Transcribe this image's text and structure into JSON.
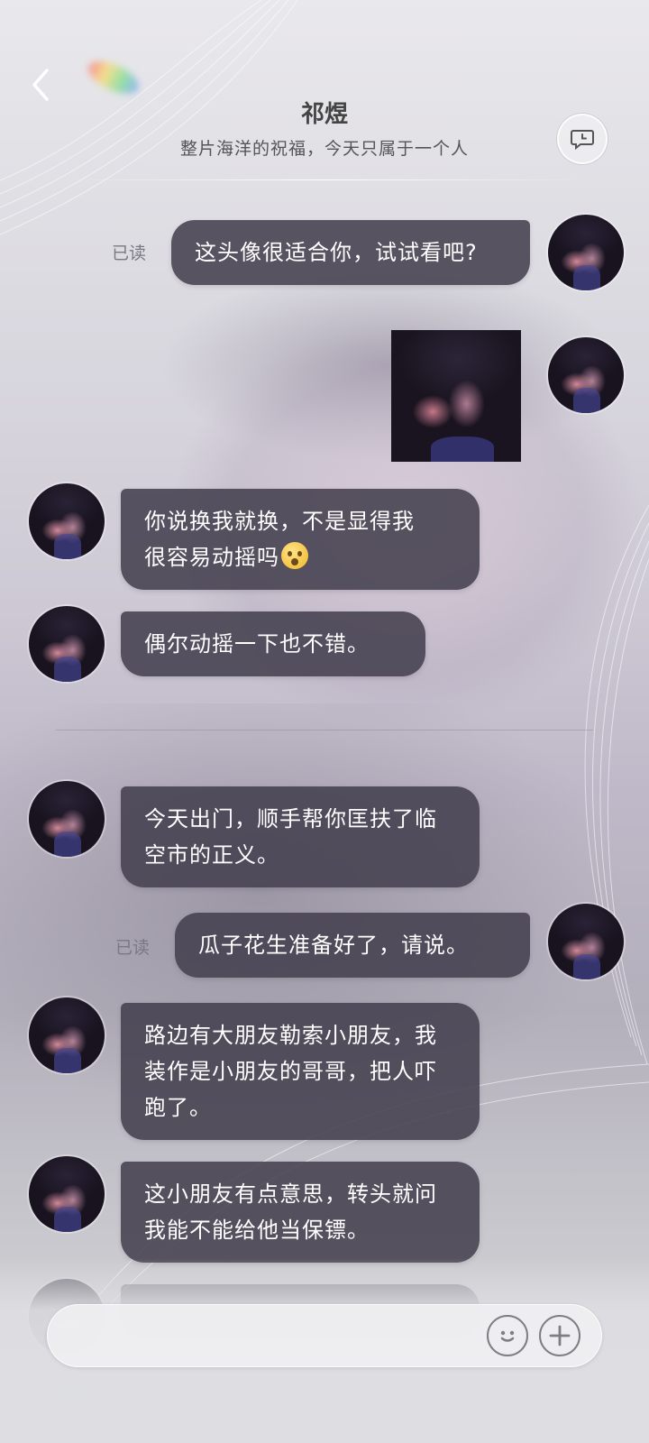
{
  "header": {
    "back_icon": "chevron-left-icon",
    "title": "祁煜",
    "subtitle": "整片海洋的祝福，今天只属于一个人",
    "history_icon": "chat-history-icon"
  },
  "messages": [
    {
      "side": "out",
      "read": "已读",
      "text": "这头像很适合你，试试看吧?"
    },
    {
      "side": "out",
      "type": "image"
    },
    {
      "side": "in",
      "text_1": "你说换我就换，不是显得我",
      "text_2": "很容易动摇吗",
      "emoji": "surprised-emoji"
    },
    {
      "side": "in",
      "text": "偶尔动摇一下也不错。"
    },
    {
      "side": "in",
      "text": "今天出门，顺手帮你匡扶了临空市的正义。"
    },
    {
      "side": "out",
      "read": "已读",
      "text": "瓜子花生准备好了，请说。"
    },
    {
      "side": "in",
      "text": "路边有大朋友勒索小朋友，我装作是小朋友的哥哥，把人吓跑了。"
    },
    {
      "side": "in",
      "text": "这小朋友有点意思，转头就问我能不能给他当保镖。"
    }
  ],
  "input_bar": {
    "value": "",
    "emoji_icon": "smiley-icon",
    "plus_icon": "plus-icon"
  },
  "colors": {
    "bubble": "#44404e",
    "bubble_text": "#ffffff",
    "read_label": "#7a7882"
  }
}
